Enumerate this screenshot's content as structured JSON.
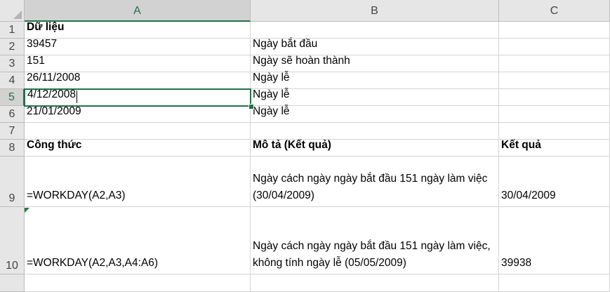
{
  "columns": [
    "A",
    "B",
    "C"
  ],
  "rows": [
    "1",
    "2",
    "3",
    "4",
    "5",
    "6",
    "7",
    "8",
    "9",
    "10"
  ],
  "cells": {
    "A1": "Dữ liệu",
    "A2": "39457",
    "B2": "Ngày bắt đầu",
    "A3": "151",
    "B3": "Ngày sẽ hoàn thành",
    "A4": "26/11/2008",
    "B4": "Ngày lễ",
    "A5": "4/12/2008",
    "B5": "Ngày lễ",
    "A6": "21/01/2009",
    "B6": "Ngày lễ",
    "A8": "Công thức",
    "B8": "Mô tả (Kết quả)",
    "C8": "Kết quả",
    "A9": "=WORKDAY(A2,A3)",
    "B9": "Ngày cách ngày ngày bắt đầu 151 ngày làm việc (30/04/2009)",
    "C9": "30/04/2009",
    "A10": "=WORKDAY(A2,A3,A4:A6)",
    "B10": "Ngày cách ngày ngày bắt đầu 151 ngày làm việc, không tính ngày lễ (05/05/2009)",
    "C10": "39938"
  },
  "selection": {
    "active_cell": "A5",
    "active_column": "A",
    "active_row": "5"
  },
  "colors": {
    "accent": "#217346",
    "header_bg": "#e6e6e6",
    "grid": "#d4d4d4"
  }
}
